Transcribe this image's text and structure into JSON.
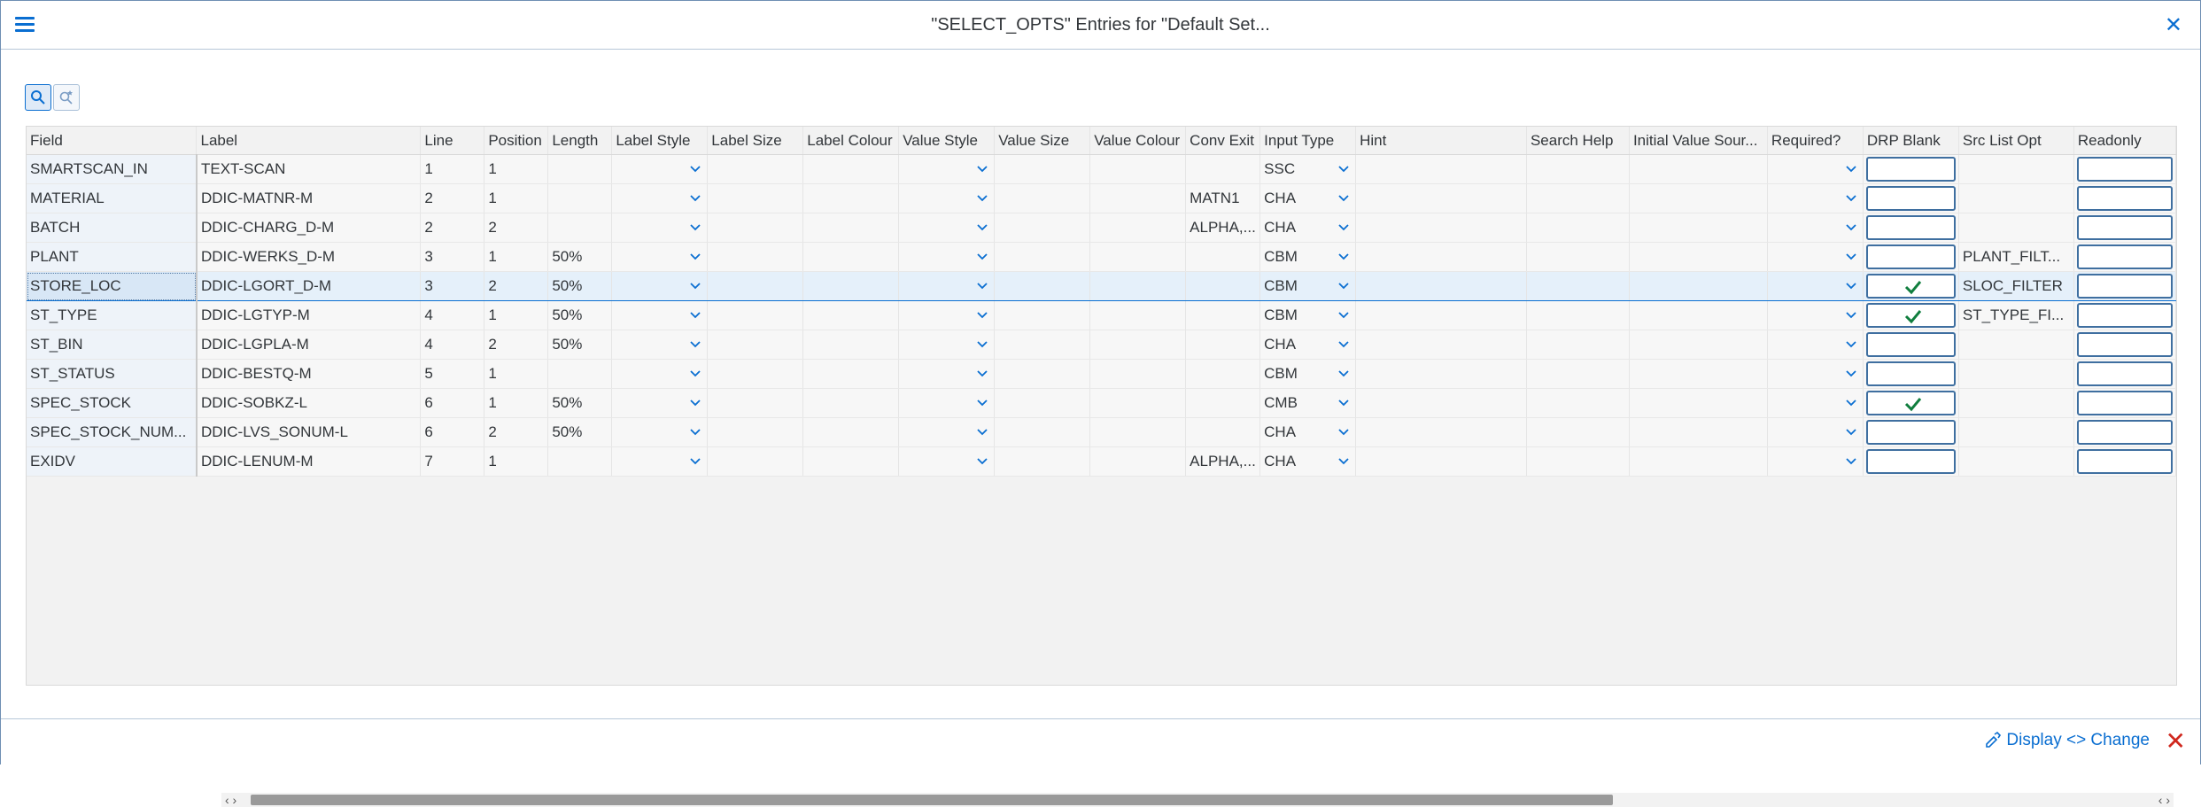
{
  "dialog": {
    "title": "\"SELECT_OPTS\" Entries for \"Default Set...",
    "close_glyph": "✕"
  },
  "toolbar": {
    "items": [
      {
        "icon": "search-icon"
      },
      {
        "icon": "search-settings-icon"
      }
    ]
  },
  "table": {
    "columns": [
      "Field",
      "Label",
      "Line",
      "Position",
      "Length",
      "Label Style",
      "Label Size",
      "Label Colour",
      "Value Style",
      "Value Size",
      "Value Colour",
      "Conv Exit",
      "Input Type",
      "Hint",
      "Search Help",
      "Initial Value Sour...",
      "Required?",
      "DRP Blank",
      "Src List Opt",
      "Readonly"
    ],
    "rows": [
      {
        "field": "SMARTSCAN_IN",
        "label": "TEXT-SCAN",
        "line": "1",
        "position": "1",
        "length": "",
        "conv_exit": "",
        "input_type": "SSC",
        "drp_blank": false,
        "src_list_opt": ""
      },
      {
        "field": "MATERIAL",
        "label": "DDIC-MATNR-M",
        "line": "2",
        "position": "1",
        "length": "",
        "conv_exit": "MATN1",
        "input_type": "CHA",
        "drp_blank": false,
        "src_list_opt": ""
      },
      {
        "field": "BATCH",
        "label": "DDIC-CHARG_D-M",
        "line": "2",
        "position": "2",
        "length": "",
        "conv_exit": "ALPHA,...",
        "input_type": "CHA",
        "drp_blank": false,
        "src_list_opt": ""
      },
      {
        "field": "PLANT",
        "label": "DDIC-WERKS_D-M",
        "line": "3",
        "position": "1",
        "length": "50%",
        "conv_exit": "",
        "input_type": "CBM",
        "drp_blank": false,
        "src_list_opt": "PLANT_FILT..."
      },
      {
        "field": "STORE_LOC",
        "label": "DDIC-LGORT_D-M",
        "line": "3",
        "position": "2",
        "length": "50%",
        "conv_exit": "",
        "input_type": "CBM",
        "drp_blank": true,
        "src_list_opt": "SLOC_FILTER",
        "selected": true
      },
      {
        "field": "ST_TYPE",
        "label": "DDIC-LGTYP-M",
        "line": "4",
        "position": "1",
        "length": "50%",
        "conv_exit": "",
        "input_type": "CBM",
        "drp_blank": true,
        "src_list_opt": "ST_TYPE_FI..."
      },
      {
        "field": "ST_BIN",
        "label": "DDIC-LGPLA-M",
        "line": "4",
        "position": "2",
        "length": "50%",
        "conv_exit": "",
        "input_type": "CHA",
        "drp_blank": false,
        "src_list_opt": ""
      },
      {
        "field": "ST_STATUS",
        "label": "DDIC-BESTQ-M",
        "line": "5",
        "position": "1",
        "length": "",
        "conv_exit": "",
        "input_type": "CBM",
        "drp_blank": false,
        "src_list_opt": ""
      },
      {
        "field": "SPEC_STOCK",
        "label": "DDIC-SOBKZ-L",
        "line": "6",
        "position": "1",
        "length": "50%",
        "conv_exit": "",
        "input_type": "CMB",
        "drp_blank": true,
        "src_list_opt": ""
      },
      {
        "field": "SPEC_STOCK_NUM...",
        "label": "DDIC-LVS_SONUM-L",
        "line": "6",
        "position": "2",
        "length": "50%",
        "conv_exit": "",
        "input_type": "CHA",
        "drp_blank": false,
        "src_list_opt": ""
      },
      {
        "field": "EXIDV",
        "label": "DDIC-LENUM-M",
        "line": "7",
        "position": "1",
        "length": "",
        "conv_exit": "ALPHA,...",
        "input_type": "CHA",
        "drp_blank": false,
        "src_list_opt": ""
      }
    ]
  },
  "scrollbar": {
    "left_arrows": "‹ ›",
    "right_arrows": "‹ ›"
  },
  "footer": {
    "toggle_label": "Display <> Change",
    "close_glyph": "✕"
  },
  "colors": {
    "accent": "#0a6ed1",
    "close_red": "#d0271d",
    "selected_row": "#e5f0fa"
  }
}
